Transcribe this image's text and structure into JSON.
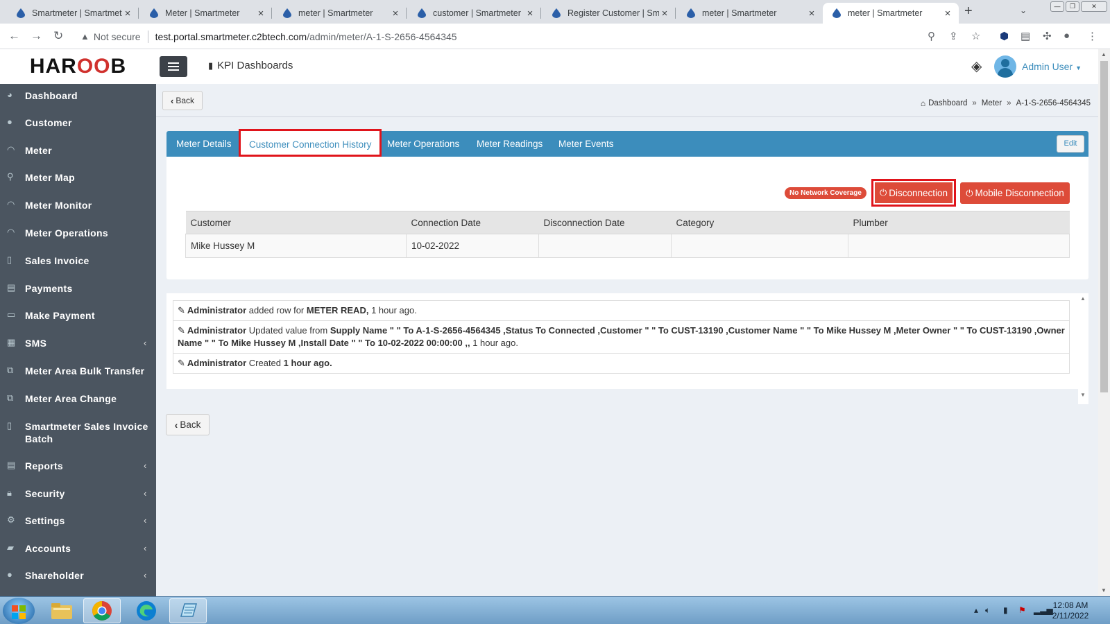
{
  "browser": {
    "tabs": [
      {
        "title": "Smartmeter | Smartmeter",
        "active": false
      },
      {
        "title": "Meter | Smartmeter",
        "active": false
      },
      {
        "title": "meter | Smartmeter",
        "active": false
      },
      {
        "title": "customer | Smartmeter",
        "active": false
      },
      {
        "title": "Register Customer | Smartmeter",
        "active": false
      },
      {
        "title": "meter | Smartmeter",
        "active": false
      },
      {
        "title": "meter | Smartmeter",
        "active": true
      }
    ],
    "security_label": "Not secure",
    "url_host": "test.portal.smartmeter.c2btech.com",
    "url_path": "/admin/meter/A-1-S-2656-4564345"
  },
  "header": {
    "logo_pre": "HAR",
    "logo_mid": "OO",
    "logo_post": "B",
    "kpi_label": "KPI Dashboards",
    "user_name": "Admin User"
  },
  "sidebar": {
    "items": [
      {
        "label": "Dashboard",
        "icon": "dashboard-icon"
      },
      {
        "label": "Customer",
        "icon": "user-icon"
      },
      {
        "label": "Meter",
        "icon": "gauge-icon"
      },
      {
        "label": "Meter Map",
        "icon": "map-marker-icon"
      },
      {
        "label": "Meter Monitor",
        "icon": "gauge-icon"
      },
      {
        "label": "Meter Operations",
        "icon": "gauge-icon"
      },
      {
        "label": "Sales Invoice",
        "icon": "file-icon"
      },
      {
        "label": "Payments",
        "icon": "list-icon"
      },
      {
        "label": "Make Payment",
        "icon": "credit-card-icon"
      },
      {
        "label": "SMS",
        "icon": "server-icon"
      },
      {
        "label": "Meter Area Bulk Transfer",
        "icon": "transfer-icon"
      },
      {
        "label": "Meter Area Change",
        "icon": "transfer-icon"
      },
      {
        "label": "Smartmeter Sales Invoice Batch",
        "icon": "file-icon"
      },
      {
        "label": "Reports",
        "icon": "book-icon"
      },
      {
        "label": "Security",
        "icon": "lock-icon"
      },
      {
        "label": "Settings",
        "icon": "gear-icon"
      },
      {
        "label": "Accounts",
        "icon": "book-icon"
      },
      {
        "label": "Shareholder",
        "icon": "user-icon"
      }
    ]
  },
  "content": {
    "back_label": "Back",
    "breadcrumb": [
      "Dashboard",
      "Meter",
      "A-1-S-2656-4564345"
    ],
    "tabs": [
      "Meter Details",
      "Customer Connection History",
      "Meter Operations",
      "Meter Readings",
      "Meter Events"
    ],
    "active_tab": "Customer Connection History",
    "edit_label": "Edit",
    "no_network_badge": "No Network Coverage",
    "disconnection_label": "Disconnection",
    "mobile_disconnection_label": "Mobile Disconnection",
    "table": {
      "columns": [
        "Customer",
        "Connection Date",
        "Disconnection Date",
        "Category",
        "Plumber"
      ],
      "rows": [
        [
          "Mike Hussey M",
          "10-02-2022",
          "",
          "",
          ""
        ]
      ]
    },
    "activity": [
      {
        "actor": "Administrator",
        "pre": "added row for",
        "value": "METER READ,",
        "time": "1 hour ago."
      },
      {
        "actor": "Administrator",
        "pre": "Updated value from",
        "value": "Supply Name \" \" To A-1-S-2656-4564345 ,Status To Connected ,Customer \" \" To CUST-13190 ,Customer Name \" \" To Mike Hussey M ,Meter Owner \" \" To CUST-13190 ,Owner Name \" \" To Mike Hussey M ,Install Date \" \" To 10-02-2022 00:00:00 ,,",
        "time": "1 hour ago."
      },
      {
        "actor": "Administrator",
        "pre": "Created",
        "value": "",
        "time": "1 hour ago."
      }
    ],
    "bottom_back_label": "Back"
  },
  "taskbar": {
    "time": "12:08 AM",
    "date": "2/11/2022"
  },
  "colors": {
    "brand_blue": "#3c8dbc",
    "sidebar_bg": "#4b5560",
    "danger": "#dd4b39",
    "highlight": "#e0141b"
  }
}
